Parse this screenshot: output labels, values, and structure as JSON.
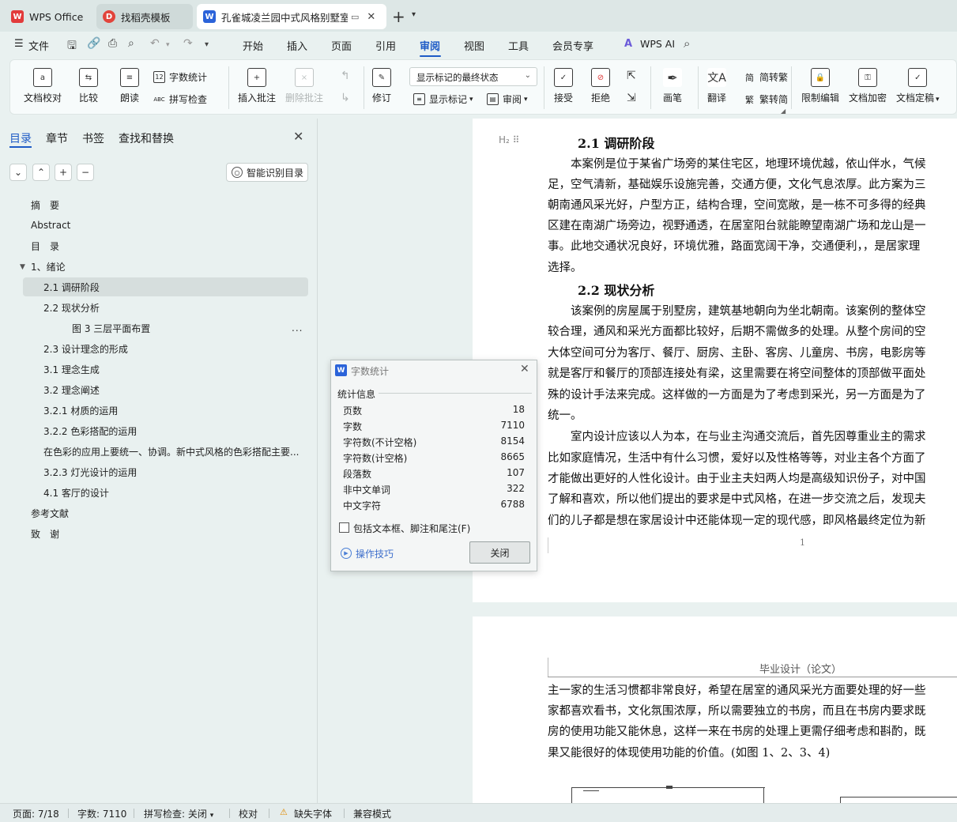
{
  "tabs": {
    "wps": "WPS Office",
    "templates": "找稻壳模板",
    "document": "孔雀城凌兰园中式风格别墅室内设计"
  },
  "menubar": {
    "file": "文件",
    "tabs": [
      "开始",
      "插入",
      "页面",
      "引用",
      "审阅",
      "视图",
      "工具",
      "会员专享"
    ],
    "active_tab": "审阅",
    "ai": "WPS AI"
  },
  "ribbon": {
    "proofread": "文档校对",
    "compare": "比较",
    "read_aloud": "朗读",
    "word_count": "字数统计",
    "spell_check": "拼写检查",
    "insert_comment": "插入批注",
    "delete_comment": "删除批注",
    "track_changes": "修订",
    "markup_mode": "显示标记的最终状态",
    "show_markup": "显示标记",
    "review": "审阅",
    "accept": "接受",
    "reject": "拒绝",
    "pen": "画笔",
    "translate": "翻译",
    "to_traditional": "简转繁",
    "to_simplified": "繁转简",
    "restrict_edit": "限制编辑",
    "encrypt": "文档加密",
    "finalize": "文档定稿"
  },
  "sidebar": {
    "tabs": [
      "目录",
      "章节",
      "书签",
      "查找和替换"
    ],
    "smart_toc": "智能识别目录",
    "toc": [
      {
        "label": "摘　要",
        "level": 1
      },
      {
        "label": "Abstract",
        "level": 1
      },
      {
        "label": "目　录",
        "level": 1
      },
      {
        "label": "1、绪论",
        "level": 1,
        "expanded": true
      },
      {
        "label": "2.1 调研阶段",
        "level": 2,
        "selected": true
      },
      {
        "label": "2.2 现状分析",
        "level": 2
      },
      {
        "label": "图 3 三层平面布置",
        "level": 3
      },
      {
        "label": "2.3 设计理念的形成",
        "level": 2
      },
      {
        "label": "3.1 理念生成",
        "level": 2
      },
      {
        "label": "3.2 理念阐述",
        "level": 2
      },
      {
        "label": "3.2.1 材质的运用",
        "level": 2
      },
      {
        "label": "3.2.2 色彩搭配的运用",
        "level": 2
      },
      {
        "label": "在色彩的应用上要统一、协调。新中式风格的色彩搭配主要...",
        "level": 2
      },
      {
        "label": "3.2.3 灯光设计的运用",
        "level": 2
      },
      {
        "label": "4.1 客厅的设计",
        "level": 2
      },
      {
        "label": "参考文献",
        "level": 1
      },
      {
        "label": "致　谢",
        "level": 1
      }
    ],
    "more": "..."
  },
  "document": {
    "page1": {
      "heading_marker": "H₂",
      "heading1": "2.1 调研阶段",
      "para1": [
        "　　本案例是位于某省广场旁的某住宅区，地理环境优越，依山伴水，气候",
        "足，空气清新，基础娱乐设施完善，交通方便，文化气息浓厚。此方案为三",
        "朝南通风采光好，户型方正，结构合理，空间宽敞，是一栋不可多得的经典",
        "区建在南湖广场旁边，视野通透，在居室阳台就能瞭望南湖广场和龙山是一",
        "事。此地交通状况良好，环境优雅，路面宽阔干净，交通便利，，是居家理",
        "选择。"
      ],
      "heading2": "2.2 现状分析",
      "para2": [
        "　　该案例的房屋属于别墅房，建筑基地朝向为坐北朝南。该案例的整体空",
        "较合理，通风和采光方面都比较好，后期不需做多的处理。从整个房间的空",
        "大体空间可分为客厅、餐厅、厨房、主卧、客房、儿童房、书房，电影房等",
        "就是客厅和餐厅的顶部连接处有梁，这里需要在将空间整体的顶部做平面处",
        "殊的设计手法来完成。这样做的一方面是为了考虑到采光，另一方面是为了",
        "统一。",
        "　　室内设计应该以人为本，在与业主沟通交流后，首先因尊重业主的需求",
        "比如家庭情况，生活中有什么习惯，爱好以及性格等等，对业主各个方面了",
        "才能做出更好的人性化设计。由于业主夫妇两人均是高级知识份子，对中国",
        "了解和喜欢，所以他们提出的要求是中式风格，在进一步交流之后，发现夫",
        "们的儿子都是想在家居设计中还能体现一定的现代感，即风格最终定位为新"
      ],
      "page_number": "1"
    },
    "page2": {
      "header": "毕业设计（论文）",
      "lines": [
        "主一家的生活习惯都非常良好，希望在居室的通风采光方面要处理的好一些",
        "家都喜欢看书，文化氛围浓厚，所以需要独立的书房，而且在书房内要求既",
        "房的使用功能又能休息，这样一来在书房的处理上更需仔细考虑和斟酌，既",
        "果又能很好的体现使用功能的价值。(如图 1、2、3、4)"
      ]
    }
  },
  "word_count_dialog": {
    "title": "字数统计",
    "section": "统计信息",
    "rows": [
      {
        "label": "页数",
        "value": "18"
      },
      {
        "label": "字数",
        "value": "7110"
      },
      {
        "label": "字符数(不计空格)",
        "value": "8154"
      },
      {
        "label": "字符数(计空格)",
        "value": "8665"
      },
      {
        "label": "段落数",
        "value": "107"
      },
      {
        "label": "非中文单词",
        "value": "322"
      },
      {
        "label": "中文字符",
        "value": "6788"
      }
    ],
    "include_textboxes": "包括文本框、脚注和尾注(F)",
    "include_checked": false,
    "tips": "操作技巧",
    "close": "关闭"
  },
  "statusbar": {
    "page": "页面: 7/18",
    "words": "字数: 7110",
    "spell": "拼写检查: 关闭",
    "proof": "校对",
    "missing_font": "缺失字体",
    "compat": "兼容模式"
  },
  "colors": {
    "accent": "#1e5bc6",
    "background": "#e9f1f0",
    "wps_red": "#e23b3b"
  }
}
